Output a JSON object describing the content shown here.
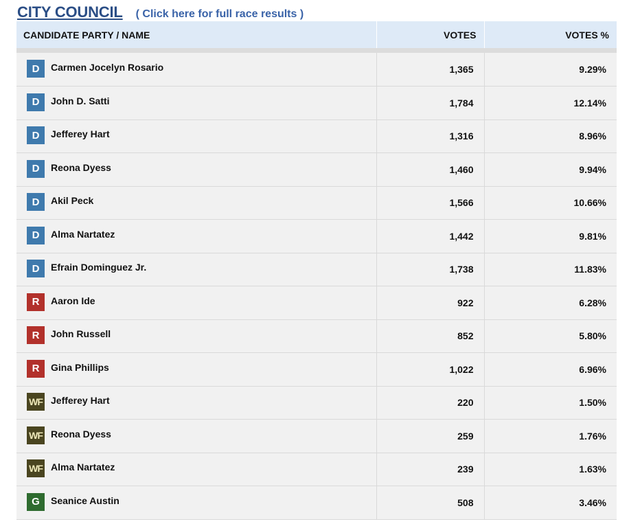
{
  "race": {
    "title": "CITY COUNCIL",
    "results_link": "( Click here for full race results )"
  },
  "columns": {
    "name": "CANDIDATE PARTY / NAME",
    "votes": "VOTES",
    "pct": "VOTES %"
  },
  "party_colors": {
    "D": "#3f7aad",
    "R": "#b2312b",
    "WF": "#4a4520",
    "G": "#2e6b2f"
  },
  "candidates": [
    {
      "party": "D",
      "name": "Carmen Jocelyn Rosario",
      "votes": "1,365",
      "pct": "9.29%"
    },
    {
      "party": "D",
      "name": "John D. Satti",
      "votes": "1,784",
      "pct": "12.14%"
    },
    {
      "party": "D",
      "name": "Jefferey Hart",
      "votes": "1,316",
      "pct": "8.96%"
    },
    {
      "party": "D",
      "name": "Reona Dyess",
      "votes": "1,460",
      "pct": "9.94%"
    },
    {
      "party": "D",
      "name": "Akil Peck",
      "votes": "1,566",
      "pct": "10.66%"
    },
    {
      "party": "D",
      "name": "Alma Nartatez",
      "votes": "1,442",
      "pct": "9.81%"
    },
    {
      "party": "D",
      "name": "Efrain Dominguez Jr.",
      "votes": "1,738",
      "pct": "11.83%"
    },
    {
      "party": "R",
      "name": "Aaron Ide",
      "votes": "922",
      "pct": "6.28%"
    },
    {
      "party": "R",
      "name": "John Russell",
      "votes": "852",
      "pct": "5.80%"
    },
    {
      "party": "R",
      "name": "Gina Phillips",
      "votes": "1,022",
      "pct": "6.96%"
    },
    {
      "party": "WF",
      "name": "Jefferey Hart",
      "votes": "220",
      "pct": "1.50%"
    },
    {
      "party": "WF",
      "name": "Reona Dyess",
      "votes": "259",
      "pct": "1.76%"
    },
    {
      "party": "WF",
      "name": "Alma Nartatez",
      "votes": "239",
      "pct": "1.63%"
    },
    {
      "party": "G",
      "name": "Seanice Austin",
      "votes": "508",
      "pct": "3.46%"
    }
  ]
}
